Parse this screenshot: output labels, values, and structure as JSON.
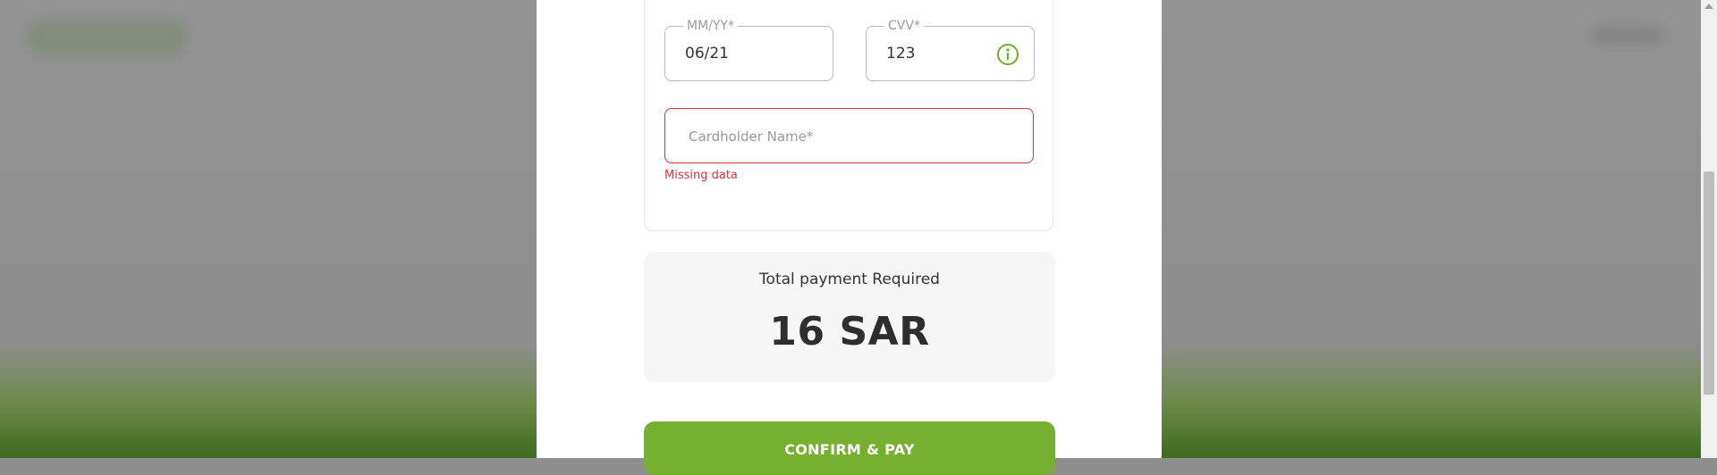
{
  "form": {
    "expiry": {
      "label": "MM/YY*",
      "value": "06/21"
    },
    "cvv": {
      "label": "CVV*",
      "value": "123",
      "icon": "info-icon"
    },
    "cardholder": {
      "placeholder": "Cardholder Name*",
      "error": "Missing data"
    }
  },
  "total": {
    "label": "Total payment Required",
    "amount": "16 SAR"
  },
  "actions": {
    "confirm_label": "CONFIRM & PAY"
  },
  "colors": {
    "accent": "#76b031",
    "error": "#e0303c",
    "info_icon": "#6fb02a"
  }
}
